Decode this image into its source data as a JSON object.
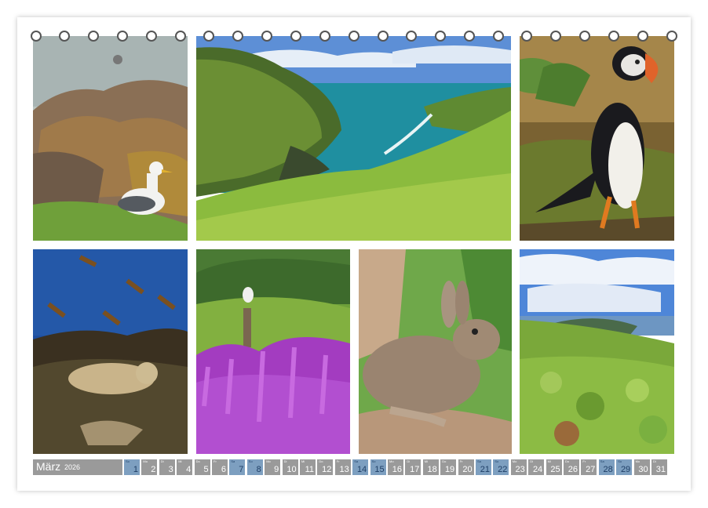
{
  "calendar": {
    "month": "März",
    "year": "2026",
    "days": [
      {
        "wd": "So",
        "d": "1",
        "we": true
      },
      {
        "wd": "Mo",
        "d": "2",
        "we": false
      },
      {
        "wd": "Di",
        "d": "3",
        "we": false
      },
      {
        "wd": "Mi",
        "d": "4",
        "we": false
      },
      {
        "wd": "Do",
        "d": "5",
        "we": false
      },
      {
        "wd": "Fr",
        "d": "6",
        "we": false
      },
      {
        "wd": "Sa",
        "d": "7",
        "we": true
      },
      {
        "wd": "So",
        "d": "8",
        "we": true
      },
      {
        "wd": "Mo",
        "d": "9",
        "we": false
      },
      {
        "wd": "Di",
        "d": "10",
        "we": false
      },
      {
        "wd": "Mi",
        "d": "11",
        "we": false
      },
      {
        "wd": "Do",
        "d": "12",
        "we": false
      },
      {
        "wd": "Fr",
        "d": "13",
        "we": false
      },
      {
        "wd": "Sa",
        "d": "14",
        "we": true
      },
      {
        "wd": "So",
        "d": "15",
        "we": true
      },
      {
        "wd": "Mo",
        "d": "16",
        "we": false
      },
      {
        "wd": "Di",
        "d": "17",
        "we": false
      },
      {
        "wd": "Mi",
        "d": "18",
        "we": false
      },
      {
        "wd": "Do",
        "d": "19",
        "we": false
      },
      {
        "wd": "Fr",
        "d": "20",
        "we": false
      },
      {
        "wd": "Sa",
        "d": "21",
        "we": true
      },
      {
        "wd": "So",
        "d": "22",
        "we": true
      },
      {
        "wd": "Mo",
        "d": "23",
        "we": false
      },
      {
        "wd": "Di",
        "d": "24",
        "we": false
      },
      {
        "wd": "Mi",
        "d": "25",
        "we": false
      },
      {
        "wd": "Do",
        "d": "26",
        "we": false
      },
      {
        "wd": "Fr",
        "d": "27",
        "we": false
      },
      {
        "wd": "Sa",
        "d": "28",
        "we": true
      },
      {
        "wd": "So",
        "d": "29",
        "we": true
      },
      {
        "wd": "Mo",
        "d": "30",
        "we": false
      },
      {
        "wd": "Di",
        "d": "31",
        "we": false
      }
    ]
  },
  "colors": {
    "day_bg": "#9a9a9a",
    "weekend_bg": "#7d9fc0",
    "weekend_text": "#1f3f66",
    "ring": "#555555"
  }
}
